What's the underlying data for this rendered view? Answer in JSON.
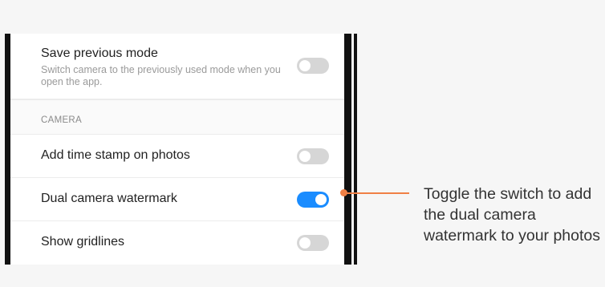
{
  "settings": {
    "save_previous_mode": {
      "title": "Save previous mode",
      "description": "Switch camera to the previously used mode when you open the app.",
      "enabled": false
    },
    "section_camera": "CAMERA",
    "add_time_stamp": {
      "title": "Add time stamp on photos",
      "enabled": false
    },
    "dual_camera_watermark": {
      "title": "Dual camera watermark",
      "enabled": true
    },
    "show_gridlines": {
      "title": "Show gridlines",
      "enabled": false
    }
  },
  "callout": {
    "text": "Toggle the switch to add the dual camera watermark to your photos"
  },
  "colors": {
    "accent": "#1a8cff",
    "callout": "#f08045",
    "toggle_off": "#d6d6d6"
  }
}
